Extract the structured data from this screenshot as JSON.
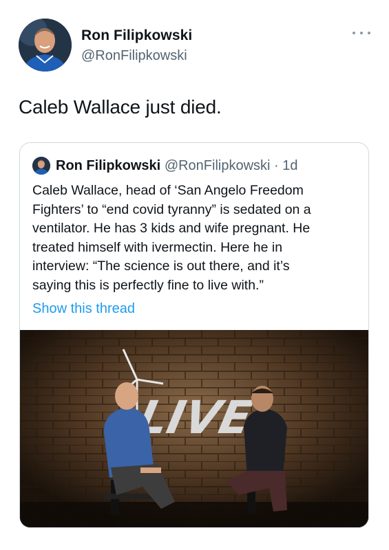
{
  "author": {
    "name": "Ron Filipkowski",
    "handle": "@RonFilipkowski"
  },
  "tweet": {
    "text": "Caleb Wallace just died."
  },
  "quoted_tweet": {
    "name": "Ron Filipkowski",
    "handle": "@RonFilipkowski",
    "separator": " · ",
    "age": "1d",
    "body_lines": [
      "Caleb Wallace, head of ‘San Angelo Freedom",
      "Fighters’ to “end covid tyranny” is sedated on a",
      "ventilator. He has 3 kids and wife pregnant. He",
      "treated himself with ivermectin. Here he in",
      "interview: “The science is out there, and it’s",
      "saying this is perfectly fine to live with.”"
    ],
    "show_thread_label": "Show this thread",
    "media": {
      "sign_text": "LIVE!",
      "description_icon": "video-still"
    }
  },
  "colors": {
    "text": "#0f1419",
    "secondary": "#536471",
    "link": "#1d9bf0",
    "border": "#cfd9de"
  }
}
